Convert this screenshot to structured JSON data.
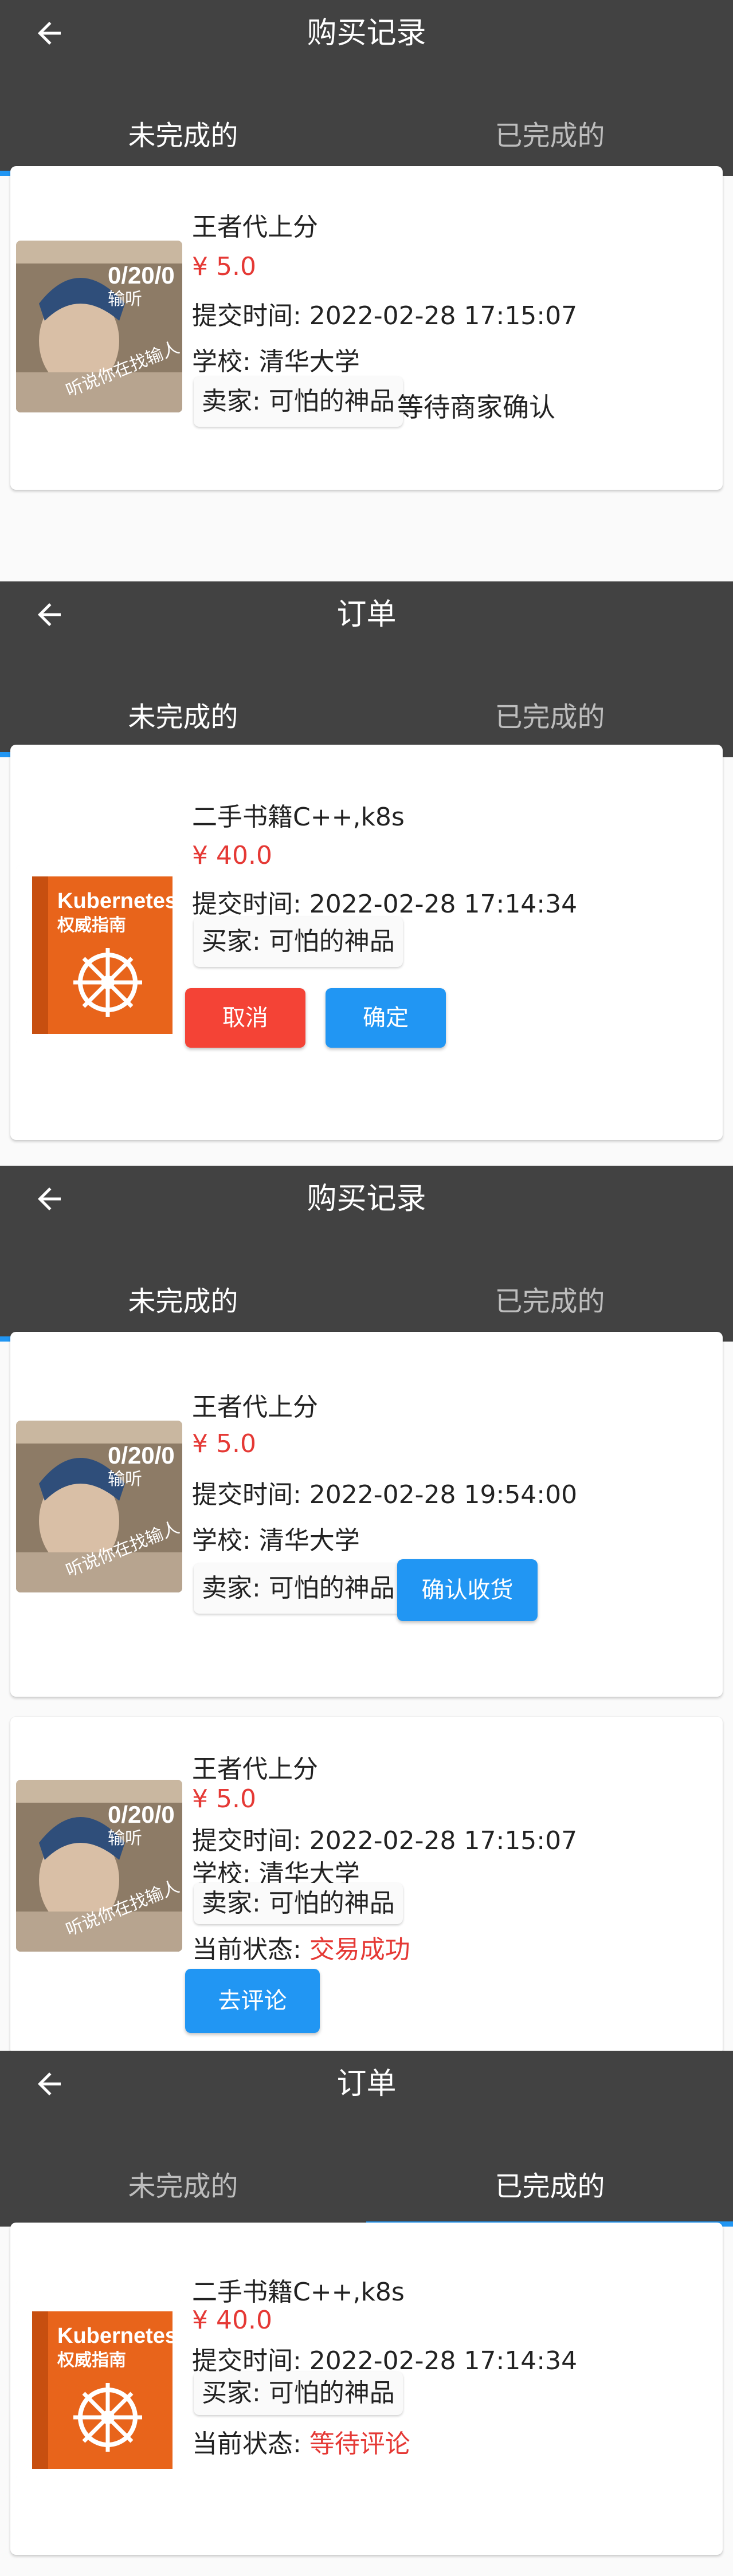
{
  "colors": {
    "appbar": "#424242",
    "accent": "#2196f3",
    "price": "#e53935",
    "danger": "#f44336"
  },
  "icons": {
    "back": "arrow-left-icon",
    "book": "book-cover-image",
    "portrait": "portrait-image"
  },
  "s1": {
    "title": "购买记录",
    "tabs": [
      "未完成的",
      "已完成的"
    ],
    "card": {
      "name": "王者代上分",
      "price": "¥ 5.0",
      "time": "提交时间: 2022-02-28 17:15:07",
      "school": "学校: 清华大学",
      "seller": "卖家: 可怕的神品",
      "status_note": "等待商家确认",
      "image": {
        "score": "0/20/0",
        "role": "输听",
        "caption": "听说你在找输人"
      }
    }
  },
  "s2": {
    "title": "订单",
    "tabs": [
      "未完成的",
      "已完成的"
    ],
    "card": {
      "name": "二手书籍C++,k8s",
      "price": "¥ 40.0",
      "time": "提交时间: 2022-02-28 17:14:34",
      "seller": "买家: 可怕的神品",
      "cancel": "取消",
      "confirm": "确定",
      "image": {
        "book_title": "Kubernetes",
        "book_sub": "权威指南"
      }
    }
  },
  "s3": {
    "title": "购买记录",
    "tabs": [
      "未完成的",
      "已完成的"
    ],
    "card1": {
      "name": "王者代上分",
      "price": "¥ 5.0",
      "time": "提交时间: 2022-02-28 19:54:00",
      "school": "学校: 清华大学",
      "seller": "卖家: 可怕的神品",
      "action": "确认收货",
      "image": {
        "score": "0/20/0",
        "role": "输听",
        "caption": "听说你在找输人"
      }
    },
    "card2": {
      "name": "王者代上分",
      "price": "¥ 5.0",
      "time": "提交时间: 2022-02-28 17:15:07",
      "school": "学校: 清华大学",
      "seller": "卖家: 可怕的神品",
      "status_label": "当前状态: ",
      "status_value": "交易成功",
      "action": "去评论",
      "image": {
        "score": "0/20/0",
        "role": "输听",
        "caption": "听说你在找输人"
      }
    }
  },
  "s4": {
    "title": "订单",
    "tabs": [
      "未完成的",
      "已完成的"
    ],
    "card": {
      "name": "二手书籍C++,k8s",
      "price": "¥ 40.0",
      "time": "提交时间: 2022-02-28 17:14:34",
      "seller": "买家: 可怕的神品",
      "status_label": "当前状态: ",
      "status_value": "等待评论",
      "image": {
        "book_title": "Kubernetes",
        "book_sub": "权威指南"
      }
    }
  }
}
